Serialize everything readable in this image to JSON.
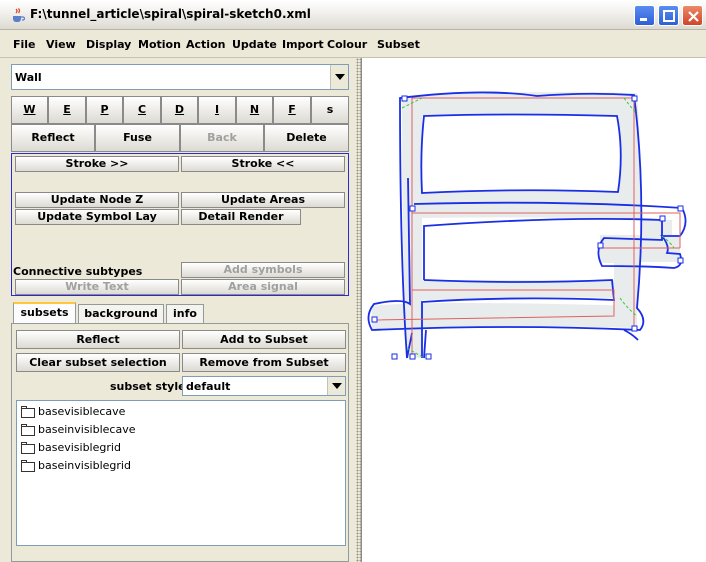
{
  "window": {
    "title": "F:\\tunnel_article\\spiral\\spiral-sketch0.xml"
  },
  "menu": [
    "File",
    "View",
    "Display",
    "Motion",
    "Action",
    "Update",
    "Import",
    "Colour",
    "Subset"
  ],
  "linestyle_combo": {
    "value": "Wall"
  },
  "linestyle_buttons": [
    "W",
    "E",
    "P",
    "C",
    "D",
    "I",
    "N",
    "F",
    "s"
  ],
  "action_buttons": {
    "reflect": "Reflect",
    "fuse": "Fuse",
    "back": "Back",
    "delete": "Delete"
  },
  "edit_panel": {
    "stroke_fwd": "Stroke >>",
    "stroke_back": "Stroke <<",
    "update_node_z": "Update Node Z",
    "update_areas": "Update Areas",
    "update_symbol_lay": "Update Symbol Lay",
    "detail_render": "Detail Render",
    "connective_subtypes": "Connective subtypes",
    "add_symbols": "Add symbols",
    "write_text": "Write Text",
    "area_signal": "Area signal"
  },
  "tabs": [
    "subsets",
    "background",
    "info"
  ],
  "subsets_panel": {
    "reflect": "Reflect",
    "add_to_subset": "Add to Subset",
    "clear_selection": "Clear subset selection",
    "remove_from_subset": "Remove from Subset",
    "style_label": "subset style:",
    "style_value": "default",
    "items": [
      "basevisiblecave",
      "baseinvisiblecave",
      "basevisiblegrid",
      "baseinvisiblegrid"
    ]
  },
  "colors": {
    "outline": "#1a2ee6",
    "centerline": "#e06060",
    "junction": "#3ac83a",
    "fill": "#e8ecec",
    "panel_border": "#2b2bd0"
  }
}
